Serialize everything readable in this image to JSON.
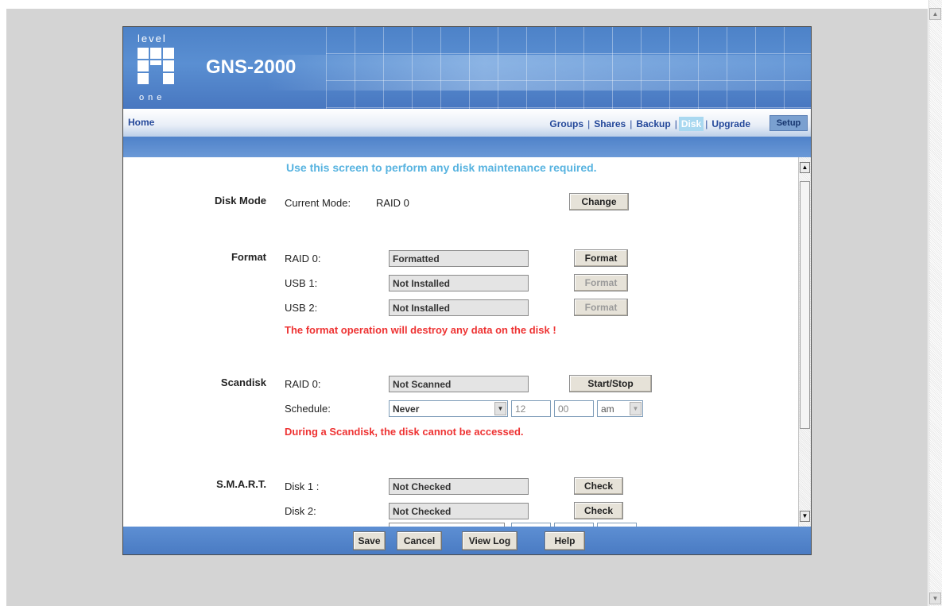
{
  "header": {
    "logo_top": "level",
    "logo_bottom": "one",
    "product": "GNS-2000"
  },
  "nav": {
    "home": "Home",
    "links": [
      "Groups",
      "Shares",
      "Backup",
      "Disk",
      "Upgrade"
    ],
    "separator": "|",
    "active": "Disk",
    "setup": "Setup"
  },
  "intro": "Use this screen to perform any disk maintenance required.",
  "disk_mode": {
    "section": "Disk Mode",
    "label": "Current Mode:",
    "value": "RAID 0",
    "button": "Change"
  },
  "format": {
    "section": "Format",
    "rows": [
      {
        "label": "RAID 0:",
        "status": "Formatted",
        "button": "Format",
        "enabled": true
      },
      {
        "label": "USB 1:",
        "status": "Not Installed",
        "button": "Format",
        "enabled": false
      },
      {
        "label": "USB 2:",
        "status": "Not Installed",
        "button": "Format",
        "enabled": false
      }
    ],
    "warning": "The format operation will destroy any data on the disk !"
  },
  "scandisk": {
    "section": "Scandisk",
    "raid_label": "RAID 0:",
    "raid_status": "Not Scanned",
    "button": "Start/Stop",
    "schedule_label": "Schedule:",
    "schedule_value": "Never",
    "hour": "12",
    "minute": "00",
    "ampm": "am",
    "warning": "During a Scandisk, the disk cannot be accessed."
  },
  "smart": {
    "section": "S.M.A.R.T.",
    "rows": [
      {
        "label": "Disk 1 :",
        "status": "Not Checked",
        "button": "Check"
      },
      {
        "label": "Disk 2:",
        "status": "Not Checked",
        "button": "Check"
      }
    ]
  },
  "footer": {
    "save": "Save",
    "cancel": "Cancel",
    "view_log": "View Log",
    "help": "Help"
  },
  "colors": {
    "banner": "#4d82c8",
    "intro_text": "#57b3e0",
    "warning_text": "#ee3333",
    "nav_text": "#24489a"
  }
}
